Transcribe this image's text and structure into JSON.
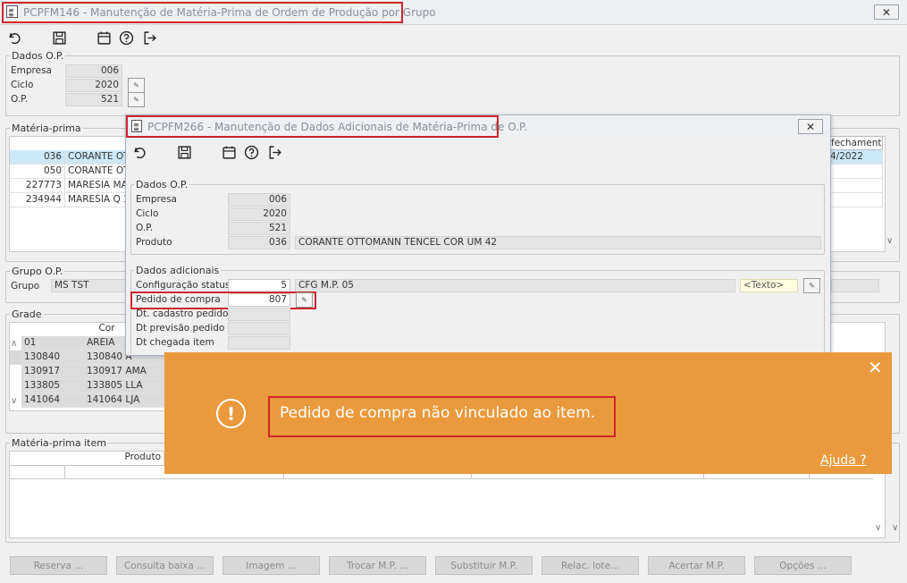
{
  "main_window": {
    "title": "PCPFM146 - Manutenção de Matéria-Prima de Ordem de Produção por Grupo",
    "close_glyph": "✕"
  },
  "dados_op": {
    "legend": "Dados O.P.",
    "empresa_label": "Empresa",
    "empresa_value": "006",
    "ciclo_label": "Ciclo",
    "ciclo_value": "2020",
    "op_label": "O.P.",
    "op_value": "521"
  },
  "materia_prima": {
    "legend": "Matéria-prima",
    "header_fechamento": "fechamento",
    "rows": [
      {
        "code": "036",
        "name": "CORANTE OT",
        "date": "4/2022"
      },
      {
        "code": "050",
        "name": "CORANTE OT",
        "date": ""
      },
      {
        "code": "227773",
        "name": "MARESIA MAT",
        "date": ""
      },
      {
        "code": "234944",
        "name": "MARESIA Q 1",
        "date": ""
      }
    ]
  },
  "grupo_op": {
    "legend": "Grupo O.P.",
    "grupo_label": "Grupo",
    "grupo_value": "MS TST"
  },
  "grade": {
    "legend": "Grade",
    "header_cor": "Cor",
    "rows": [
      {
        "code": "01",
        "cor": "AREIA"
      },
      {
        "code": "130840",
        "cor": "130840 A"
      },
      {
        "code": "130917",
        "cor": "130917 AMA"
      },
      {
        "code": "133805",
        "cor": "133805 LLA"
      },
      {
        "code": "141064",
        "cor": "141064 LJA"
      }
    ]
  },
  "materia_prima_item": {
    "legend": "Matéria-prima item",
    "header_produto": "Produto"
  },
  "bottom_buttons": [
    "Reserva ...",
    "Consulta baixa ...",
    "Imagem ...",
    "Trocar M.P. ...",
    "Substituir M.P.",
    "Relac. lote...",
    "Acertar M.P.",
    "Opções ..."
  ],
  "child_window": {
    "title": "PCPFM266 - Manutenção de Dados Adicionais de Matéria-Prima de O.P.",
    "close_glyph": "✕",
    "dados_op": {
      "legend": "Dados O.P.",
      "empresa_label": "Empresa",
      "empresa_value": "006",
      "ciclo_label": "Ciclo",
      "ciclo_value": "2020",
      "op_label": "O.P.",
      "op_value": "521",
      "produto_label": "Produto",
      "produto_code": "036",
      "produto_desc": "CORANTE OTTOMANN TENCEL COR UM 42"
    },
    "dados_adicionais": {
      "legend": "Dados adicionais",
      "config_status_label": "Configuração status",
      "config_status_value": "5",
      "config_status_desc": "CFG M.P. 05",
      "texto_value": "<Texto>",
      "pedido_compra_label": "Pedido de compra",
      "pedido_compra_value": "807",
      "dt_cadastro_label": "Dt. cadastro pedido",
      "dt_previsao_label": "Dt previsão pedido",
      "dt_chegada_label": "Dt chegada item"
    }
  },
  "toast": {
    "message": "Pedido de compra não vinculado ao item.",
    "help_link": "Ajuda ?",
    "close_glyph": "✕",
    "icon_glyph": "!"
  },
  "colors": {
    "toast_bg": "#ea9a3c",
    "highlight_outline": "#d0262a",
    "selected_row": "#cce8f8"
  },
  "icons": [
    "undo-icon",
    "save-icon",
    "calendar-icon",
    "help-icon",
    "exit-icon"
  ]
}
